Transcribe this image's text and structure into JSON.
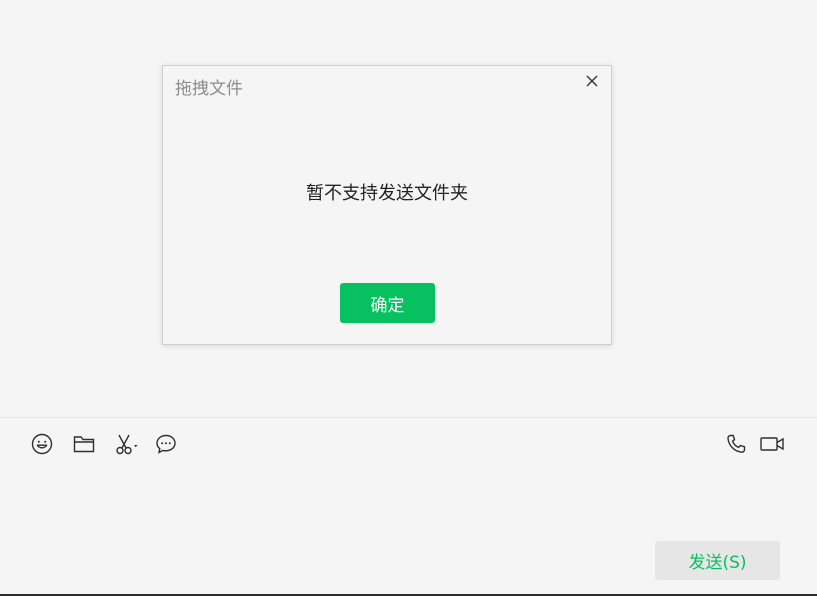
{
  "dialog": {
    "title": "拖拽文件",
    "message": "暂不支持发送文件夹",
    "confirm_label": "确定",
    "close_icon": "close-icon"
  },
  "composer": {
    "tools": [
      {
        "name": "emoji-icon"
      },
      {
        "name": "folder-icon"
      },
      {
        "name": "scissors-icon"
      },
      {
        "name": "chat-bubble-icon"
      },
      {
        "name": "phone-icon"
      },
      {
        "name": "video-call-icon"
      }
    ],
    "send_label": "发送(S)"
  },
  "colors": {
    "accent": "#07c160",
    "background": "#f5f5f5",
    "send_bg": "#e6e6e6"
  }
}
